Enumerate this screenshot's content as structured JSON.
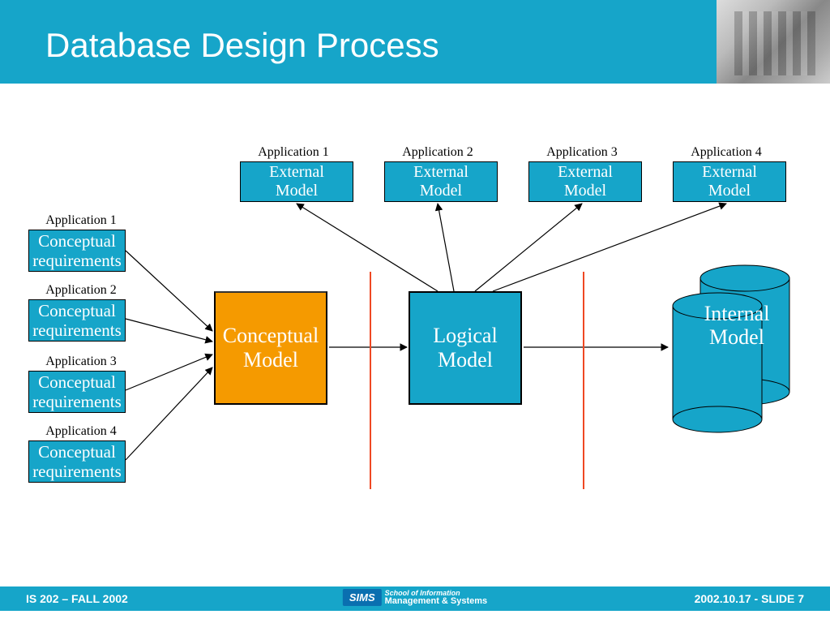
{
  "header": {
    "title": "Database Design Process"
  },
  "footer": {
    "left": "IS 202 – FALL 2002",
    "right": "2002.10.17 - SLIDE 7",
    "center_brand": "SIMS",
    "center_top": "School of Information",
    "center_bot": "Management & Systems"
  },
  "diagram": {
    "reqs": [
      {
        "app": "Application 1",
        "text": "Conceptual\nrequirements"
      },
      {
        "app": "Application 2",
        "text": "Conceptual\nrequirements"
      },
      {
        "app": "Application 3",
        "text": "Conceptual\nrequirements"
      },
      {
        "app": "Application 4",
        "text": "Conceptual\nrequirements"
      }
    ],
    "ext": [
      {
        "app": "Application 1",
        "text": "External\nModel"
      },
      {
        "app": "Application 2",
        "text": "External\nModel"
      },
      {
        "app": "Application 3",
        "text": "External\nModel"
      },
      {
        "app": "Application 4",
        "text": "External\nModel"
      }
    ],
    "conceptual": "Conceptual\nModel",
    "logical": "Logical\nModel",
    "internal": "Internal\nModel"
  }
}
